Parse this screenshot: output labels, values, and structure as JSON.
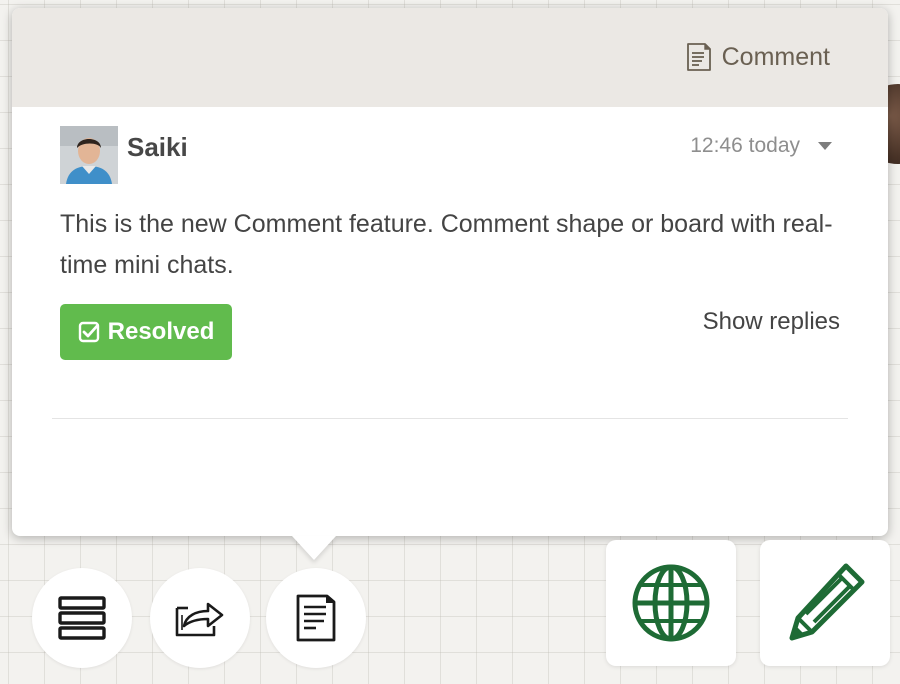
{
  "header": {
    "tab_label": "Comment",
    "tab_icon": "document-icon"
  },
  "comment": {
    "author": "Saiki",
    "timestamp": "12:46 today",
    "text": "This is the new Comment feature. Comment shape or board with real-time mini chats.",
    "resolved_label": "Resolved",
    "show_replies_label": "Show replies"
  },
  "toolbar": {
    "left_buttons": [
      "menu-icon",
      "share-icon",
      "comment-icon"
    ],
    "right_buttons": [
      "globe-icon",
      "pencil-icon"
    ]
  },
  "colors": {
    "resolved": "#61bb4d",
    "header_bg": "#ebe8e4",
    "brand_green": "#1e6b35"
  }
}
